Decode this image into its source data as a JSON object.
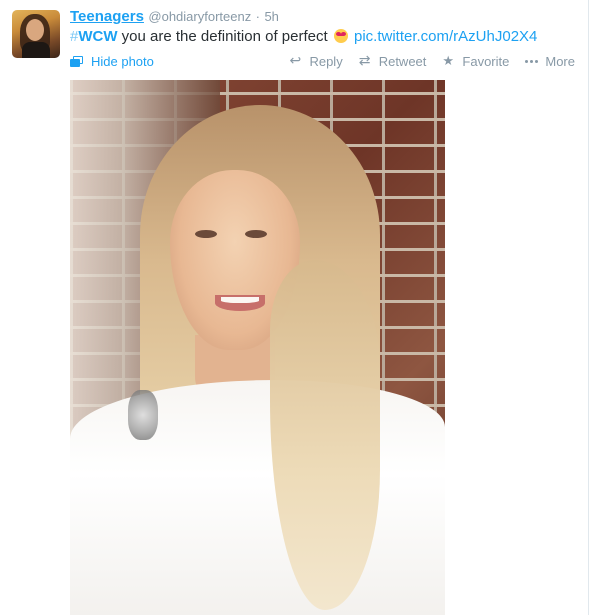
{
  "tweet": {
    "fullname": "Teenagers",
    "username": "@ohdiaryforteenz",
    "separator": "·",
    "time": "5h",
    "hashtag_symbol": "#",
    "hashtag_word": "WCW",
    "text": "you are the definition of perfect",
    "emoji": "heart-eyes-emoji",
    "link": "pic.twitter.com/rAzUhJ02X4",
    "hide_photo_label": "Hide photo"
  },
  "actions": {
    "reply": "Reply",
    "retweet": "Retweet",
    "favorite": "Favorite",
    "more": "More"
  },
  "colors": {
    "accent": "#1da1f2",
    "muted": "#8899a6",
    "text": "#292f33"
  }
}
